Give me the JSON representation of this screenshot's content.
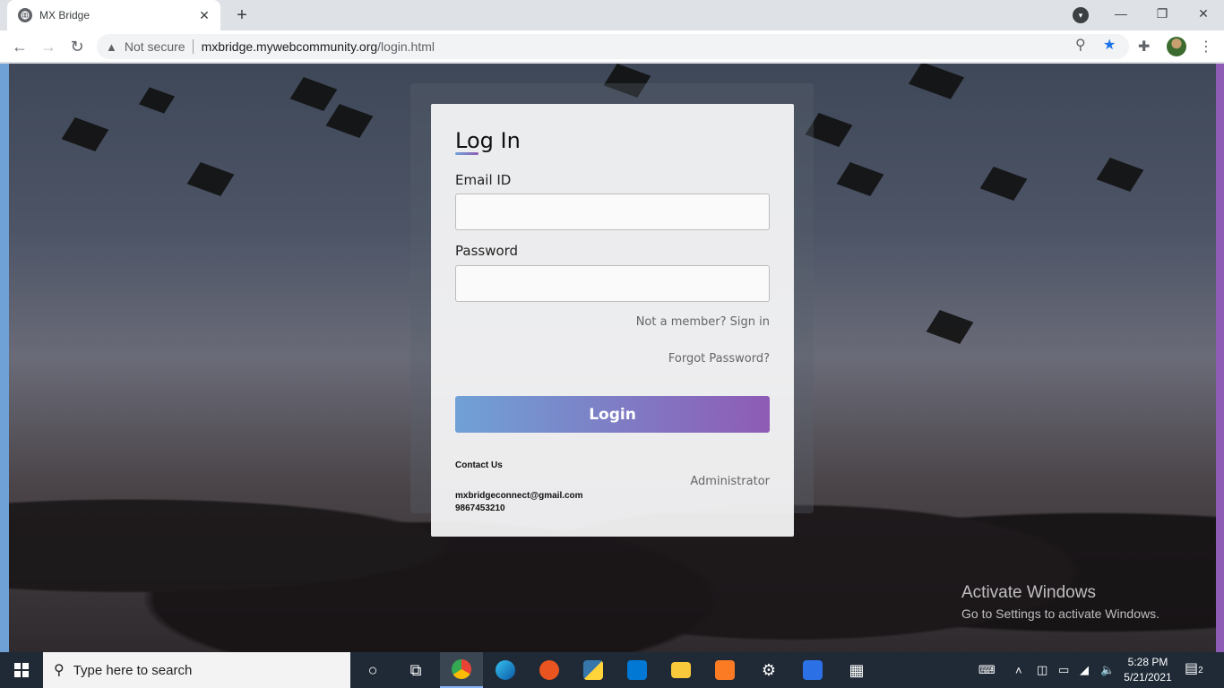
{
  "browser": {
    "tab_title": "MX Bridge",
    "url_security": "Not secure",
    "url_host": "mxbridge.mywebcommunity.org",
    "url_path": "/login.html"
  },
  "login": {
    "heading": "Log In",
    "email_label": "Email ID",
    "email_value": "",
    "password_label": "Password",
    "password_value": "",
    "signup_link": "Not a member? Sign in",
    "forgot_link": "Forgot Password?",
    "login_button": "Login",
    "contact_title": "Contact Us",
    "contact_email": "mxbridgeconnect@gmail.com",
    "contact_phone": "9867453210",
    "admin_link": "Administrator",
    "accent_start": "#6fa1d6",
    "accent_end": "#8e5bb5"
  },
  "watermark": {
    "line1": "Activate Windows",
    "line2": "Go to Settings to activate Windows."
  },
  "taskbar": {
    "search_placeholder": "Type here to search",
    "time": "5:28 PM",
    "date": "5/21/2021",
    "notification_count": "2"
  }
}
